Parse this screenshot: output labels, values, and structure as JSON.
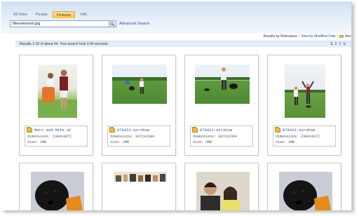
{
  "tabs": [
    {
      "label": "All Sites",
      "active": false
    },
    {
      "label": "People",
      "active": false
    },
    {
      "label": "Pictures",
      "active": true
    },
    {
      "label": "XML",
      "active": false
    }
  ],
  "search": {
    "query": "fileextension:jpg",
    "advanced_label": "Advanced Search"
  },
  "sort": {
    "prefix": "Results by Relevance",
    "separator": "|",
    "modified_link": "View by Modified Date",
    "alert_label": "Aler"
  },
  "results": {
    "summary": "Results 1-10 of about 44. Your search took 0.54 seconds.",
    "pages": [
      "1",
      "2",
      "3"
    ]
  },
  "cards": [
    {
      "title": "Matt and Mike at",
      "dimensions": "dimensions: 2304x3072",
      "size": "size: 1MB"
    },
    {
      "title": "070421-airshow",
      "dimensions": "dimensions: 3072x2304",
      "size": "size: 2MB"
    },
    {
      "title": "070421-airshow",
      "dimensions": "dimensions: 3072x2304",
      "size": "size: 2MB"
    },
    {
      "title": "070421-airshow",
      "dimensions": "dimensions: 2304x3072",
      "size": "size: 1MB"
    }
  ]
}
